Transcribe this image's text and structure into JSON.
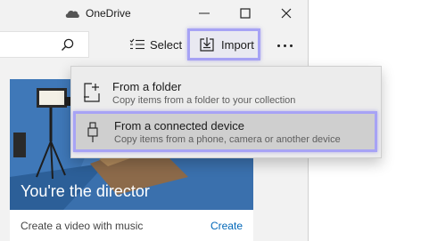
{
  "window": {
    "title": "OneDrive"
  },
  "icons": {
    "app": "onedrive-cloud-icon",
    "minimize": "minimize-icon",
    "maximize": "maximize-icon",
    "close": "close-icon",
    "search": "search-icon",
    "select": "checklist-icon",
    "import": "import-icon",
    "more": "more-dots-icon",
    "folder": "add-folder-icon",
    "device": "usb-device-icon"
  },
  "toolbar": {
    "select_label": "Select",
    "import_label": "Import"
  },
  "import_menu": {
    "items": [
      {
        "title": "From a folder",
        "subtitle": "Copy items from a folder to your collection"
      },
      {
        "title": "From a connected device",
        "subtitle": "Copy items from a phone, camera or another device"
      }
    ]
  },
  "card": {
    "title": "You're the director",
    "caption": "Create a video with music",
    "action": "Create"
  },
  "colors": {
    "highlight": "#a7a3f5",
    "link": "#0067b8",
    "card_art_sky": "#4a84c6"
  }
}
